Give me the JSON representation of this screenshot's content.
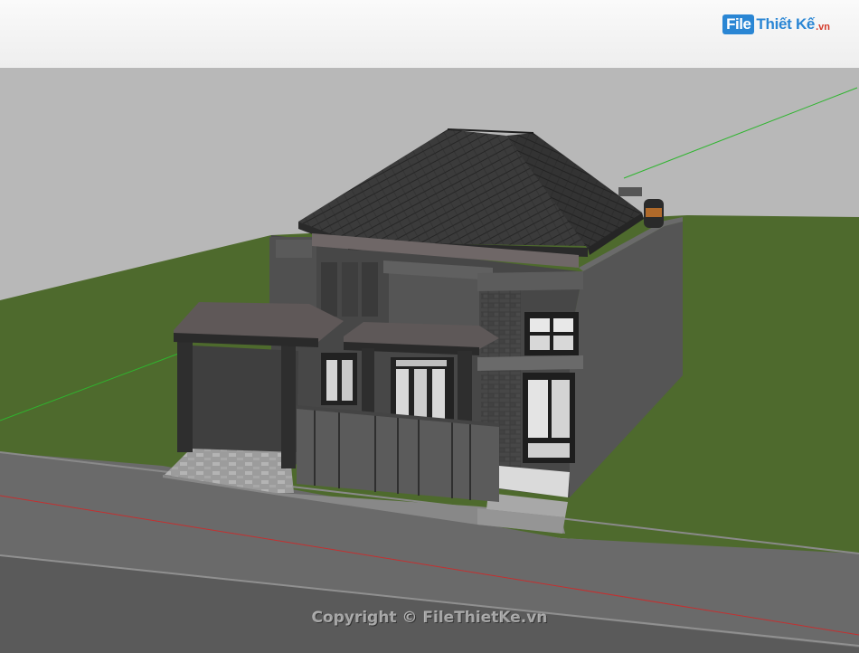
{
  "header": {
    "logo_mark": "File",
    "logo_name": "Thiết Kế",
    "logo_tld": ".vn"
  },
  "watermark": {
    "text": "Copyright © FileThietKe.vn"
  },
  "colors": {
    "sky": "#b8b8b8",
    "grass": "#4e6a2d",
    "road": "#6a6a6a",
    "roof": "#3a3a3a",
    "wall": "#4a4a4a",
    "axis_green": "#2fb52f",
    "axis_red": "#c43030"
  }
}
